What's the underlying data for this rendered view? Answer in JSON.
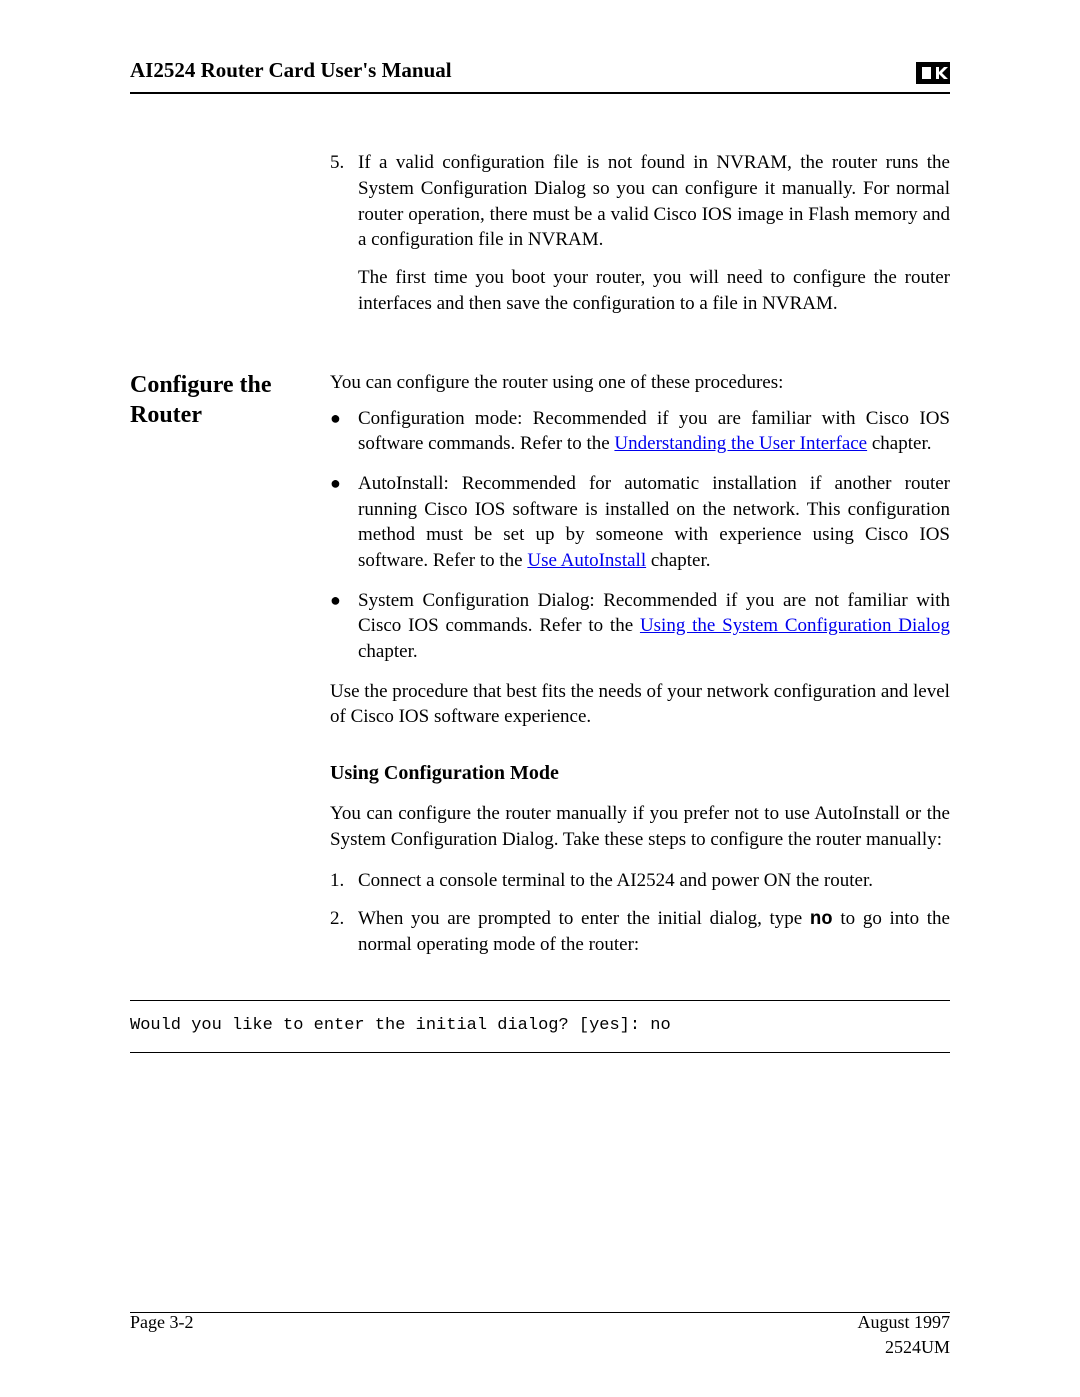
{
  "header": {
    "title": "AI2524 Router Card User's Manual"
  },
  "ol_start": {
    "items": [
      {
        "num": "5.",
        "text": "If a valid configuration file is not found in NVRAM, the router runs the System Configuration Dialog so you can configure it manually. For normal router operation, there must be a valid Cisco IOS image in Flash memory and a configuration file in NVRAM.",
        "after": "The first time you boot your router, you will need to configure the router interfaces and then save the configuration to a file in NVRAM."
      }
    ]
  },
  "section": {
    "heading": "Configure the Router",
    "intro": "You can configure the router using one of these procedures:",
    "bullets": [
      {
        "pre": "Configuration mode: Recommended if you are familiar with Cisco IOS software commands. Refer to the ",
        "link": "Understanding the User Interface",
        "post": " chapter."
      },
      {
        "pre": "AutoInstall: Recommended for automatic installation if another router running Cisco IOS software is installed on the network. This configuration method must be set up by someone with experience using Cisco IOS software. Refer to the ",
        "link": "Use AutoInstall",
        "post": " chapter."
      },
      {
        "pre": "System Configuration Dialog: Recommended if you are not familiar with Cisco IOS commands. Refer to the ",
        "link": "Using the System Configuration Dialog",
        "post": " chapter."
      }
    ],
    "closing": "Use the procedure that best fits the needs of your network configuration and level of Cisco IOS software experience."
  },
  "sub": {
    "heading": "Using Configuration Mode",
    "para": "You can configure the router manually if you prefer not to use AutoInstall or the System Configuration Dialog. Take these steps to configure the router manually:",
    "steps": [
      {
        "num": "1.",
        "text": "Connect a console terminal to the AI2524 and power ON the router."
      },
      {
        "num": "2.",
        "pre": "When you are prompted to enter the initial dialog, type ",
        "code": "no",
        "post": " to go into the normal operating mode of the router:"
      }
    ]
  },
  "code": "Would you like to enter the initial dialog? [yes]: no",
  "footer": {
    "page": "Page 3-2",
    "date": "August 1997",
    "doc": "2524UM"
  }
}
